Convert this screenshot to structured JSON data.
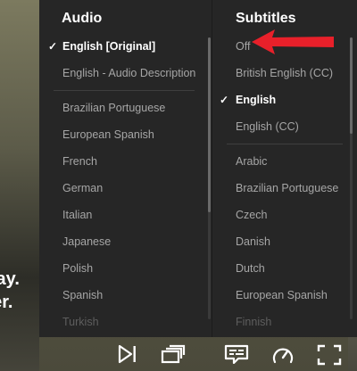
{
  "background": {
    "caption_lines": [
      "way.",
      "ker."
    ]
  },
  "audio": {
    "title": "Audio",
    "items": [
      {
        "label": "English [Original]",
        "selected": true
      },
      {
        "label": "English - Audio Description",
        "selected": false
      },
      {
        "label": "Brazilian Portuguese",
        "selected": false
      },
      {
        "label": "European Spanish",
        "selected": false
      },
      {
        "label": "French",
        "selected": false
      },
      {
        "label": "German",
        "selected": false
      },
      {
        "label": "Italian",
        "selected": false
      },
      {
        "label": "Japanese",
        "selected": false
      },
      {
        "label": "Polish",
        "selected": false
      },
      {
        "label": "Spanish",
        "selected": false
      },
      {
        "label": "Turkish",
        "selected": false
      }
    ],
    "check_glyph": "✓"
  },
  "subtitles": {
    "title": "Subtitles",
    "items": [
      {
        "label": "Off",
        "selected": false
      },
      {
        "label": "British English (CC)",
        "selected": false
      },
      {
        "label": "English",
        "selected": true
      },
      {
        "label": "English (CC)",
        "selected": false
      },
      {
        "label": "Arabic",
        "selected": false
      },
      {
        "label": "Brazilian Portuguese",
        "selected": false
      },
      {
        "label": "Czech",
        "selected": false
      },
      {
        "label": "Danish",
        "selected": false
      },
      {
        "label": "Dutch",
        "selected": false
      },
      {
        "label": "European Spanish",
        "selected": false
      },
      {
        "label": "Finnish",
        "selected": false
      }
    ],
    "check_glyph": "✓"
  },
  "annotation": {
    "color": "#e8202a",
    "icon": "arrow-left-icon"
  },
  "controls": {
    "icons": [
      "next-episode-icon",
      "episodes-icon",
      "audio-subtitles-icon",
      "playback-speed-icon",
      "fullscreen-icon"
    ],
    "color": "#ffffff"
  },
  "colors": {
    "panel": "#262626",
    "selected_text": "#ffffff",
    "item_text": "#a6a6a6"
  }
}
